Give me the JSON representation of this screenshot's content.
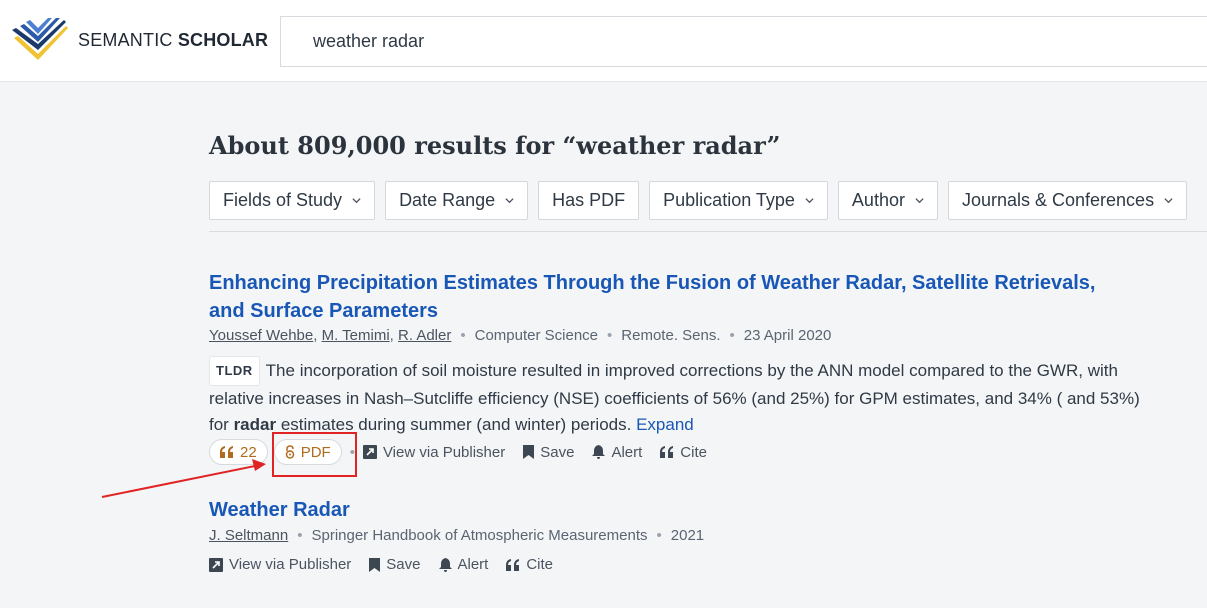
{
  "brand": {
    "name_regular": "SEMANTIC",
    "name_bold": "SCHOLAR"
  },
  "search": {
    "value": "weather radar"
  },
  "results": {
    "heading": "About 809,000 results for “weather radar”"
  },
  "filters": [
    {
      "label": "Fields of Study",
      "dropdown": true
    },
    {
      "label": "Date Range",
      "dropdown": true
    },
    {
      "label": "Has PDF",
      "dropdown": false
    },
    {
      "label": "Publication Type",
      "dropdown": true
    },
    {
      "label": "Author",
      "dropdown": true
    },
    {
      "label": "Journals & Conferences",
      "dropdown": true
    }
  ],
  "papers": [
    {
      "title": "Enhancing Precipitation Estimates Through the Fusion of Weather Radar, Satellite Retrievals, and Surface Parameters",
      "authors": [
        "Youssef Wehbe",
        "M. Temimi",
        "R. Adler"
      ],
      "field": "Computer Science",
      "venue": "Remote. Sens.",
      "date": "23 April 2020",
      "tldr_badge": "TLDR",
      "tldr_before": "The incorporation of soil moisture resulted in improved corrections by the ANN model compared to the GWR, with relative increases in Nash–Sutcliffe efficiency (NSE) coefficients of 56% (and 25%) for GPM estimates, and 34% ( and 53%) for ",
      "tldr_highlight": "radar",
      "tldr_after": " estimates during summer (and winter) periods.",
      "expand": "Expand",
      "citations": "22",
      "pdf": "PDF",
      "actions": {
        "publisher": "View via Publisher",
        "save": "Save",
        "alert": "Alert",
        "cite": "Cite"
      }
    },
    {
      "title": "Weather Radar",
      "authors": [
        "J. Seltmann"
      ],
      "venue": "Springer Handbook of Atmospheric Measurements",
      "date": "2021",
      "actions": {
        "publisher": "View via Publisher",
        "save": "Save",
        "alert": "Alert",
        "cite": "Cite"
      }
    }
  ],
  "colors": {
    "link": "#1857b6",
    "accent_orange": "#b06b1e",
    "annotation_red": "#e02424"
  }
}
